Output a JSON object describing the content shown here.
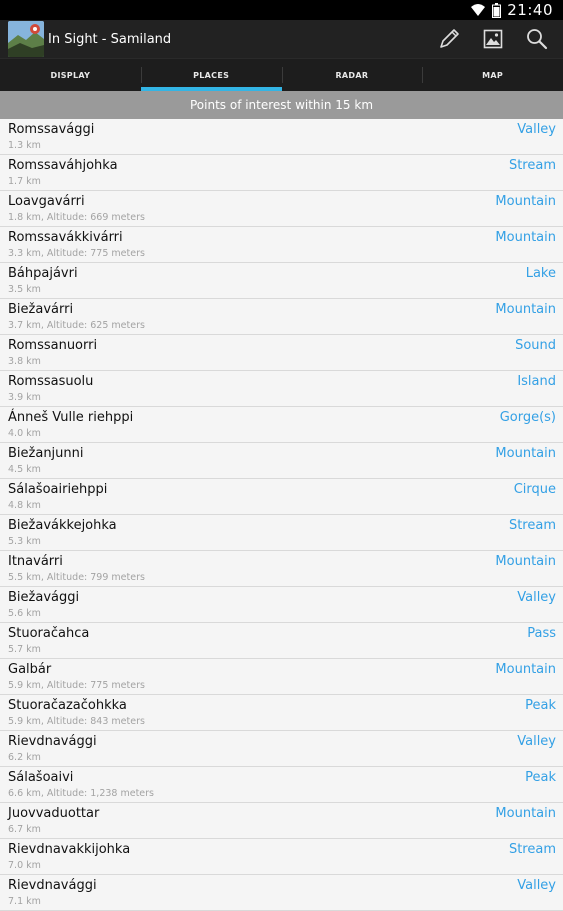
{
  "status_bar": {
    "time": "21:40",
    "icons": [
      "wifi-icon",
      "battery-icon"
    ]
  },
  "action_bar": {
    "title": "In Sight - Samiland",
    "icons": [
      "pencil-icon",
      "image-icon",
      "search-icon"
    ]
  },
  "tabs": [
    {
      "label": "DISPLAY",
      "active": false
    },
    {
      "label": "PLACES",
      "active": true
    },
    {
      "label": "RADAR",
      "active": false
    },
    {
      "label": "MAP",
      "active": false
    }
  ],
  "section_header": "Points of interest within 15 km",
  "colors": {
    "accent": "#33b5e5",
    "type_text": "#33a0e5",
    "header_bg": "#9a9a9a"
  },
  "places": [
    {
      "name": "Romssavággi",
      "detail": "1.3 km",
      "type": "Valley"
    },
    {
      "name": "Romssaváhjohka",
      "detail": "1.7 km",
      "type": "Stream"
    },
    {
      "name": "Loavgavárri",
      "detail": "1.8 km, Altitude: 669 meters",
      "type": "Mountain"
    },
    {
      "name": "Romssavákkivárri",
      "detail": "3.3 km, Altitude: 775 meters",
      "type": "Mountain"
    },
    {
      "name": "Báhpajávri",
      "detail": "3.5 km",
      "type": "Lake"
    },
    {
      "name": "Biežavárri",
      "detail": "3.7 km, Altitude: 625 meters",
      "type": "Mountain"
    },
    {
      "name": "Romssanuorri",
      "detail": "3.8 km",
      "type": "Sound"
    },
    {
      "name": "Romssasuolu",
      "detail": "3.9 km",
      "type": "Island"
    },
    {
      "name": "Ánneš Vulle riehppi",
      "detail": "4.0 km",
      "type": "Gorge(s)"
    },
    {
      "name": "Biežanjunni",
      "detail": "4.5 km",
      "type": "Mountain"
    },
    {
      "name": "Sálašoairiehppi",
      "detail": "4.8 km",
      "type": "Cirque"
    },
    {
      "name": "Biežavákkejohka",
      "detail": "5.3 km",
      "type": "Stream"
    },
    {
      "name": "Itnavárri",
      "detail": "5.5 km, Altitude: 799 meters",
      "type": "Mountain"
    },
    {
      "name": "Biežavággi",
      "detail": "5.6 km",
      "type": "Valley"
    },
    {
      "name": "Stuoračahca",
      "detail": "5.7 km",
      "type": "Pass"
    },
    {
      "name": "Galbár",
      "detail": "5.9 km, Altitude: 775 meters",
      "type": "Mountain"
    },
    {
      "name": "Stuoračazačohkka",
      "detail": "5.9 km, Altitude: 843 meters",
      "type": "Peak"
    },
    {
      "name": "Rievdnavággi",
      "detail": "6.2 km",
      "type": "Valley"
    },
    {
      "name": "Sálašoaivi",
      "detail": "6.6 km, Altitude: 1,238 meters",
      "type": "Peak"
    },
    {
      "name": "Juovvaduottar",
      "detail": "6.7 km",
      "type": "Mountain"
    },
    {
      "name": "Rievdnavakkijohka",
      "detail": "7.0 km",
      "type": "Stream"
    },
    {
      "name": "Rievdnavággi",
      "detail": "7.1 km",
      "type": "Valley"
    }
  ]
}
